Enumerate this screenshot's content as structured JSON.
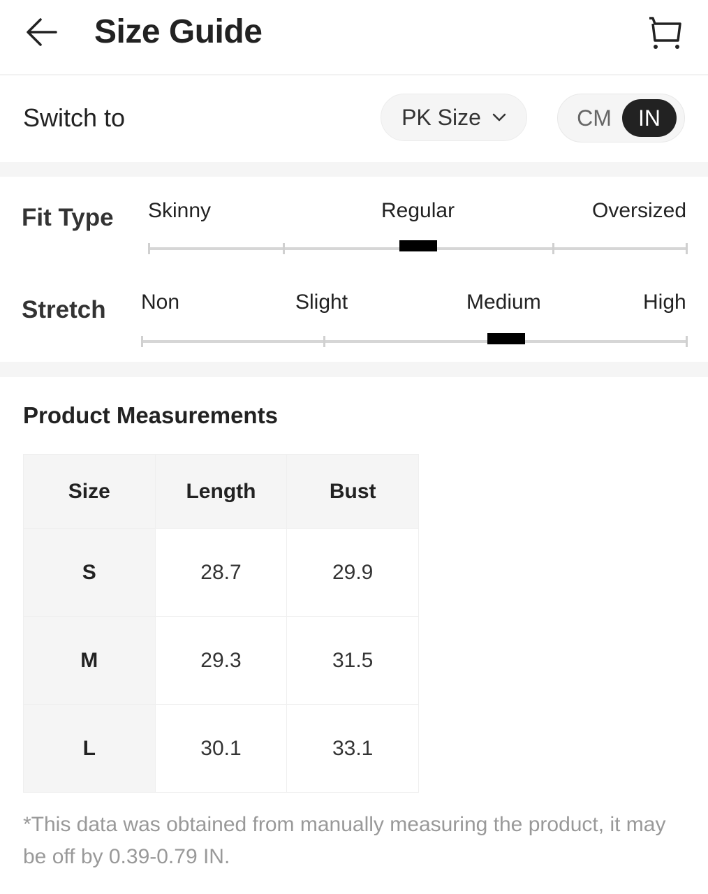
{
  "header": {
    "title": "Size Guide",
    "back_icon": "arrow-left-icon",
    "cart_icon": "shopping-cart-icon"
  },
  "switch_row": {
    "label": "Switch to",
    "size_system": {
      "selected": "PK Size",
      "icon": "chevron-down-icon"
    },
    "unit_toggle": {
      "options": [
        "CM",
        "IN"
      ],
      "selected": "IN"
    }
  },
  "fit_type": {
    "label": "Fit Type",
    "options": [
      "Skinny",
      "Regular",
      "Oversized"
    ],
    "selected": "Regular",
    "position_fraction": 0.5
  },
  "stretch": {
    "label": "Stretch",
    "options": [
      "Non",
      "Slight",
      "Medium",
      "High"
    ],
    "selected": "Medium",
    "position_fraction": 0.667
  },
  "measurements": {
    "title": "Product Measurements",
    "columns": [
      "Size",
      "Length",
      "Bust"
    ],
    "rows": [
      {
        "size": "S",
        "length": "28.7",
        "bust": "29.9"
      },
      {
        "size": "M",
        "length": "29.3",
        "bust": "31.5"
      },
      {
        "size": "L",
        "length": "30.1",
        "bust": "33.1"
      }
    ],
    "note": "*This data was obtained from manually measuring the product, it may be off by 0.39-0.79 IN."
  },
  "colors": {
    "accent_dark": "#222222",
    "section_bg": "#f5f5f5",
    "muted_text": "#999999"
  }
}
